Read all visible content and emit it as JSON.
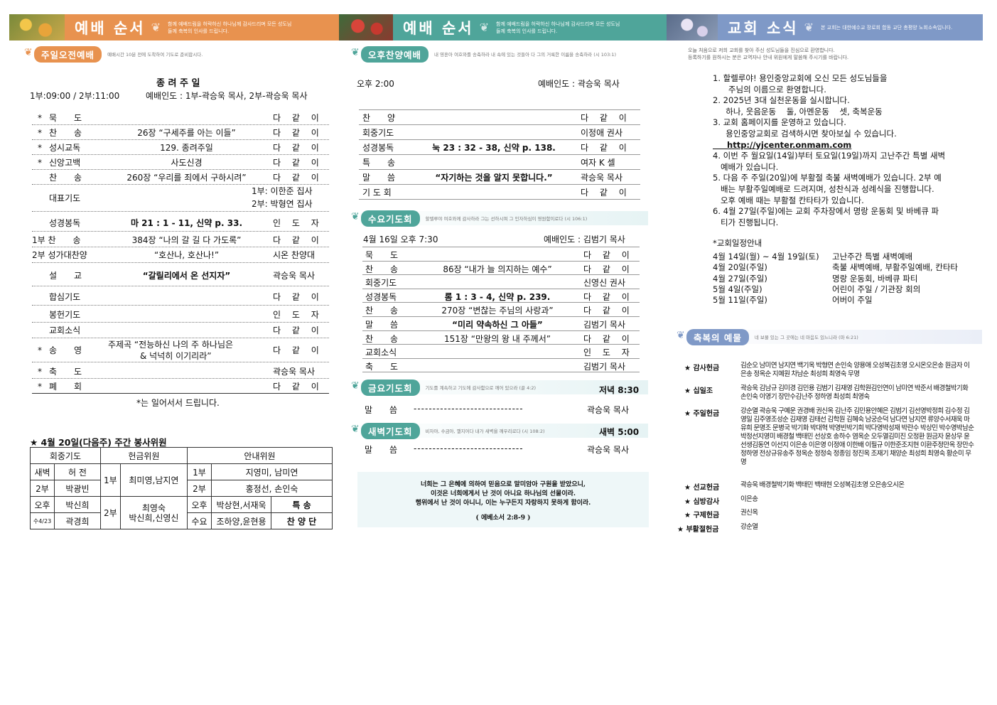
{
  "banners": {
    "left": {
      "title": "예배 순서",
      "sub": "함께 예배드림을 허락하신 하나님께 감사드리며 모든 성도님들께 축복의 인사를 드립니다.",
      "color": "#e8924f"
    },
    "middle": {
      "title": "예배 순서",
      "sub": "함께 예배드림을 허락하신 하나님께 감사드리며 모든 성도님들께 축복의 인사를 드립니다.",
      "color": "#4fa59a"
    },
    "right": {
      "title": "교회 소식",
      "sub": "본 교회는 대한예수교 장로회 합동 교단 총평양 노회소속입니다.",
      "color": "#7f99c7"
    }
  },
  "morning": {
    "header": "주일오전예배",
    "desc": "예배시간 10분 전에 도착하여 기도로 준비합시다.",
    "title": "종 려 주 일",
    "times": "1부:09:00 / 2부:11:00",
    "leader": "예배인도 : 1부-곽승욱 목사, 2부-곽승욱 목사",
    "items": [
      {
        "star": "*",
        "name": "묵　　도",
        "content": "",
        "by": "다 같 이"
      },
      {
        "star": "*",
        "name": "찬　　송",
        "content": "26장 “구세주를 아는 이들”",
        "by": "다 같 이"
      },
      {
        "star": "*",
        "name": "성시교독",
        "content": "129. 종려주일",
        "by": "다 같 이"
      },
      {
        "star": "*",
        "name": "신앙고백",
        "content": "사도신경",
        "by": "다 같 이"
      },
      {
        "star": "",
        "name": "찬　　송",
        "content": "260장 “우리를 죄에서 구하시려”",
        "by": "다 같 이"
      },
      {
        "star": "",
        "name": "대표기도",
        "content": "",
        "by": "1부: 이한준 집사",
        "by2": "2부: 박형연 집사"
      },
      {
        "star": "",
        "name": "성경봉독",
        "content": "마 21 : 1 - 11, 신약 p. 33.",
        "by": "인 도 자"
      },
      {
        "star": "",
        "name": "1부 찬　　송",
        "content": "384장 “나의 갈 길 다 가도록”",
        "by": "다 같 이"
      },
      {
        "star": "",
        "name": "2부 성가대찬양",
        "content": "“호산나, 호산나!”",
        "by": "시온 찬양대"
      },
      {
        "star": "",
        "name": "설　　교",
        "content": "“갈릴리에서 온 선지자”",
        "by": "곽승욱 목사"
      },
      {
        "star": "",
        "name": "합심기도",
        "content": "",
        "by": "다 같 이"
      },
      {
        "star": "",
        "name": "봉헌기도",
        "content": "",
        "by": "인 도 자"
      },
      {
        "star": "",
        "name": "교회소식",
        "content": "",
        "by": "다 같 이"
      },
      {
        "star": "*",
        "name": "송　　영",
        "content": "주제곡 “전능하신 나의 주 하나님은",
        "content2": "& 넉넉히 이기리라”",
        "by": "다 같 이"
      },
      {
        "star": "*",
        "name": "축　　도",
        "content": "",
        "by": "곽승욱 목사"
      },
      {
        "star": "*",
        "name": "폐　　회",
        "content": "",
        "by": "다 같 이"
      }
    ],
    "note": "*는 일어서서 드립니다."
  },
  "duty": {
    "title": "★ 4월 20일(다음주) 주간 봉사위원",
    "headers": [
      "회중기도",
      "헌금위원",
      "안내위원"
    ],
    "r1": [
      "새벽",
      "허 전",
      "1부",
      "최미영,남지연",
      "1부",
      "지영미, 남미연"
    ],
    "r2": [
      "2부",
      "박광빈",
      "2부",
      "홍정선, 손인숙"
    ],
    "r3": [
      "오후",
      "박신희",
      "2부",
      "최영숙",
      "박신희,신영신",
      "오후",
      "박상현,서재욱",
      "특 송"
    ],
    "r4": [
      "수4/23",
      "곽경희",
      "수요",
      "조하양,윤현용",
      "찬 양 단"
    ]
  },
  "afternoon": {
    "header": "오후찬양예배",
    "desc": "내 영혼아 여호와를 송축하라 내 속에 있는 것들아 다 그의 거룩한 이름을 송축하라 (시 103:1)",
    "time": "오후 2:00",
    "leader": "예배인도 : 곽승욱 목사",
    "items": [
      {
        "name": "찬　　양",
        "content": "",
        "by": "다 같 이"
      },
      {
        "name": "회중기도",
        "content": "",
        "by": "이정애 권사"
      },
      {
        "name": "성경봉독",
        "content": "눅 23 : 32 - 38, 신약 p. 138.",
        "by": "다 같 이"
      },
      {
        "name": "특　　송",
        "content": "",
        "by": "여자 K 셀"
      },
      {
        "name": "말　　씀",
        "content": "“자기하는 것을 알지 못합니다.”",
        "by": "곽승욱 목사"
      },
      {
        "name": "기 도 회",
        "content": "",
        "by": "다 같 이"
      }
    ]
  },
  "wednesday": {
    "header": "수요기도회",
    "desc": "할렐루야 여호와께 감사하라 그는 선하시며 그 인자하심이 영원함이로다 (시 106:1)",
    "time": "4월 16일 오후 7:30",
    "leader": "예배인도 : 김범기 목사",
    "items": [
      {
        "name": "묵　　도",
        "content": "",
        "by": "다 같 이"
      },
      {
        "name": "찬　　송",
        "content": "86장 “내가 늘 의지하는 예수”",
        "by": "다 같 이"
      },
      {
        "name": "회중기도",
        "content": "",
        "by": "신영신 권사"
      },
      {
        "name": "성경봉독",
        "content": "롬 1 : 3 - 4, 신약 p. 239.",
        "by": "다 같 이"
      },
      {
        "name": "찬　　송",
        "content": "270장 “변찮는 주님의 사랑과”",
        "by": "다 같 이"
      },
      {
        "name": "말　　씀",
        "content": "“미리 약속하신 그 아들”",
        "by": "김범기 목사"
      },
      {
        "name": "찬　　송",
        "content": "151장 “만왕의 왕 내 주께서”",
        "by": "다 같 이"
      },
      {
        "name": "교회소식",
        "content": "",
        "by": "인 도 자"
      },
      {
        "name": "축　　도",
        "content": "",
        "by": "김범기 목사"
      }
    ]
  },
  "friday": {
    "header": "금요기도회",
    "desc": "기도를 계속하고 기도에 감사함으로 깨어 있으라 (골 4:2)",
    "time": "저녁 8:30",
    "name": "말　　씀",
    "dashes": "-----------------------------",
    "by": "곽승욱 목사"
  },
  "dawn": {
    "header": "새벽기도회",
    "desc": "비자야, 수금아, 깰지어다 내가 새벽을 깨우리로다 (시 108:2)",
    "time": "새벽 5:00",
    "name": "말　　씀",
    "dashes": "-----------------------------",
    "by": "곽승욱 목사"
  },
  "verse": {
    "l1": "너희는 그 은혜에 의하여 믿음으로 말미암아 구원을 받았으니,",
    "l2": "이것은 너희에게서 난 것이 아니요 하나님의 선물이라.",
    "l3": "행위에서 난 것이 아니니, 이는 누구든지 자랑하지 못하게 함이라.",
    "ref": "( 에베소서 2:8-9 )"
  },
  "news": {
    "intro1": "오늘 처음으로 저희 교회를 찾아 주신 성도님들을 진심으로 환영합니다.",
    "intro2": "등록하기를 원하시는 분은 교역자나 안내 위원에게 말씀해 주시기를 바랍니다.",
    "items": [
      "1. 할렐루야! 용인중앙교회에 오신 모든 성도님들을",
      "      주님의 이름으로 환영합니다.",
      "2. 2025년 3대 실천운동을 실시합니다.",
      "     하나, 웃음운동    둘, 아멘운동    셋, 축복운동",
      "3. 교회 홈페이지를 운영하고 있습니다.",
      "     용인중앙교회로 검색하시면 찾아보실 수 있습니다.",
      "     http://yjcenter.onmam.com",
      "4. 이번 주 월요일(14일)부터 토요일(19일)까지 고난주간 특별 새벽",
      "   예배가 있습니다.",
      "5. 다음 주 주일(20일)에 부활절 축불 새벽예배가 있습니다. 2부 예",
      "   배는 부활주일예배로 드려지며, 성찬식과 성례식을 진행합니다.",
      "   오후 예배 때는 부활절 칸타타가 있습니다.",
      "6. 4월 27일(주일)에는 교회 주차장에서 명랑 운동회 및 바베큐 파",
      "   티가 진행됩니다."
    ],
    "schedule_title": "*교회일정안내",
    "schedule": [
      {
        "date": "4월 14일(월) ~ 4월 19일(토)",
        "event": "고난주간 특별 새벽예배"
      },
      {
        "date": "4월 20일(주일)",
        "event": "축불 새벽예배, 부활주일예배, 칸타타"
      },
      {
        "date": "4월 27일(주일)",
        "event": "명랑 운동회, 바베큐 파티"
      },
      {
        "date": "5월 4일(주일)",
        "event": "어린이 주일 / 기관장 회의"
      },
      {
        "date": "5월 11일(주일)",
        "event": "어버이 주일"
      }
    ]
  },
  "blessing": {
    "header": "축복의 예물",
    "desc": "네 보물 있는 그 곳에는 네 마음도 있느니라 (마 6:21)",
    "groups": [
      {
        "label": "★ 감사헌금",
        "text": "김순오 남미연 남지연 백기옥 박형연 손인숙 양용애 오성복김초영 오시온오은송 원금자 이은송 정옥순 지예원 차남순 최성희 최영숙 무명"
      },
      {
        "label": "★ 십일조",
        "text": "곽승욱 김남규 김미경 김민용 김범기 김재영 김학원김인연이 남미연 박준서 배경철박기화 손인숙 이영기 장만수김난주 정하영 최성희 최영숙"
      },
      {
        "label": "★ 주일헌금",
        "text": "강순열 곽승욱 구예운 권경배 권신옥 김난주 김민용안혜은 김범기 김선영박정희 김수정 김영일 김주영조성순 김재영 김태선 김학원 김혜숙 남궁순덕 남다연 남지연 류양수서재욱 마유희 문명조 문병국 박기화 박대혁 박영빈박기희 박다영박성재 박란수 박상민 박수영박남순 박정선지영미 배경철 백태민 선상호 송하수 염옥순 오두열김미진 오정환 원금자 윤상무 윤선생김동연 이선지 이은송 이은영 이정애 이한배 이필규 이한준조지현 이환주정만옥 장만수 정하영 전상규유송주 정옥순 정정숙 정종임 정진옥 조재기 채양순 최성희 최영숙 황순미 무명"
      },
      {
        "label": "★ 선교헌금",
        "text": "곽승욱 배경철박기화 백태민 백태현 오성복김초영 오은송오시온"
      },
      {
        "label": "★ 심방감사",
        "text": "이은송"
      },
      {
        "label": "★ 구제헌금",
        "text": "권신옥"
      },
      {
        "label": "★ 부활절헌금",
        "text": "강순열"
      }
    ]
  }
}
